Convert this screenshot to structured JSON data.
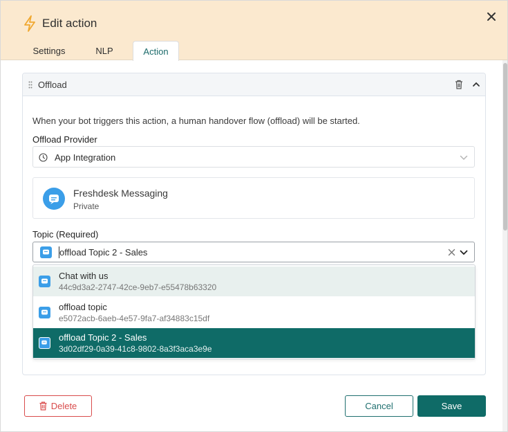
{
  "header": {
    "title": "Edit action"
  },
  "tabs": [
    {
      "label": "Settings"
    },
    {
      "label": "NLP"
    },
    {
      "label": "Action"
    }
  ],
  "card": {
    "title": "Offload",
    "description": "When your bot triggers this action, a human handover flow (offload) will be started."
  },
  "provider": {
    "label": "Offload Provider",
    "value": "App Integration",
    "card_name": "Freshdesk Messaging",
    "card_sub": "Private"
  },
  "topic": {
    "label": "Topic (Required)",
    "value": "offload Topic 2 - Sales",
    "options": [
      {
        "name": "Chat with us",
        "id": "44c9d3a2-2747-42ce-9eb7-e55478b63320"
      },
      {
        "name": "offload topic",
        "id": "e5072acb-6aeb-4e57-9fa7-af34883c15df"
      },
      {
        "name": "offload Topic 2 - Sales",
        "id": "3d02df29-0a39-41c8-9802-8a3f3aca3e9e"
      }
    ]
  },
  "footer": {
    "delete_label": "Delete",
    "cancel_label": "Cancel",
    "save_label": "Save"
  },
  "colors": {
    "header_bg": "#fbe9cf",
    "accent": "#0f6b67",
    "danger": "#d94b4b",
    "option_hover": "#e8f0ee",
    "option_selected": "#0f6b67",
    "brand_icon": "#3b9ee8"
  }
}
